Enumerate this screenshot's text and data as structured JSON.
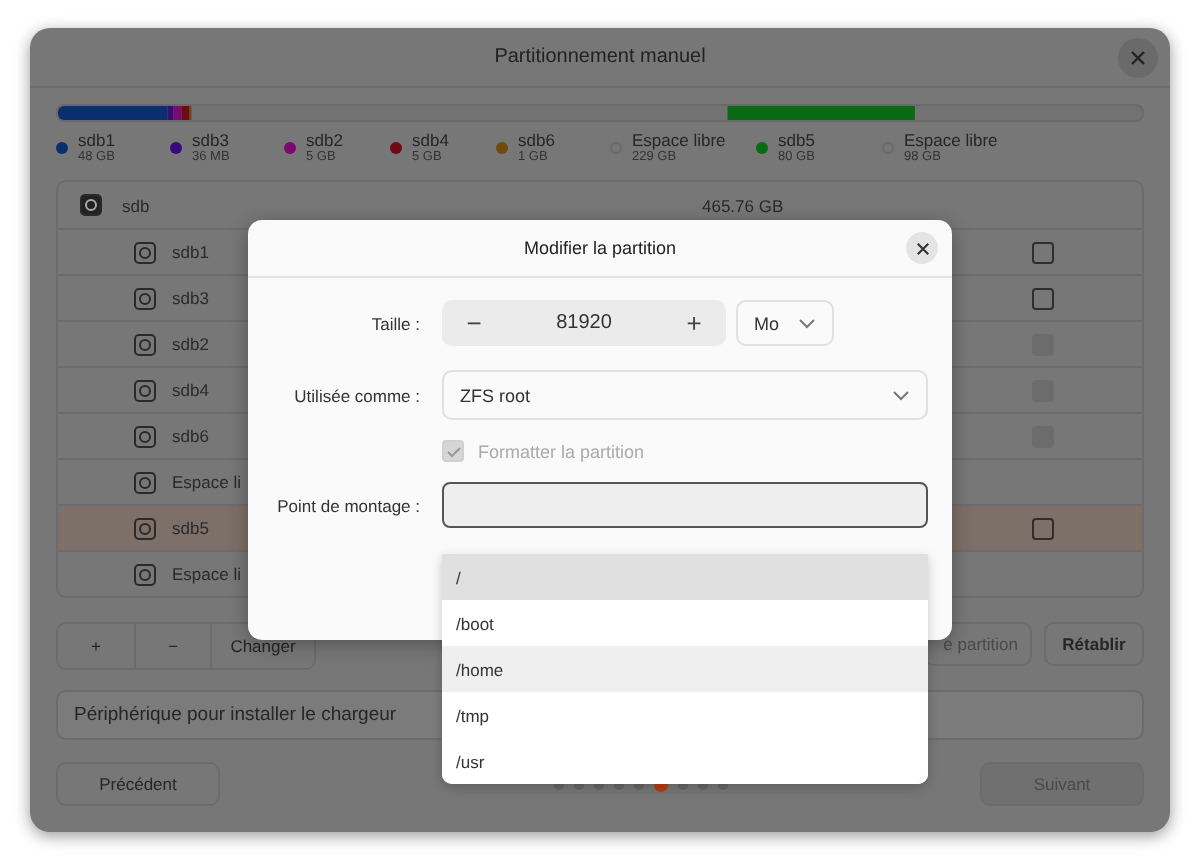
{
  "window": {
    "title": "Partitionnement manuel"
  },
  "usage_bar": [
    {
      "name": "sdb1",
      "size": "48 GB",
      "kind": "partition",
      "color": "#0a2f6e"
    },
    {
      "name": "sdb3",
      "size": "36 MB",
      "kind": "partition",
      "color": "#3a0a7a"
    },
    {
      "name": "sdb2",
      "size": "5 GB",
      "kind": "partition",
      "color": "#7a0a6e"
    },
    {
      "name": "sdb4",
      "size": "5 GB",
      "kind": "partition",
      "color": "#6e0a14"
    },
    {
      "name": "sdb6",
      "size": "1 GB",
      "kind": "partition",
      "color": "#6e4a10"
    },
    {
      "name": "Espace libre",
      "size": "229 GB",
      "kind": "free"
    },
    {
      "name": "sdb5",
      "size": "80 GB",
      "kind": "partition",
      "color": "#0a6a14"
    },
    {
      "name": "Espace libre",
      "size": "98 GB",
      "kind": "free"
    }
  ],
  "table": {
    "device": {
      "name": "sdb",
      "size": "465.76 GB"
    },
    "rows": [
      {
        "name": "sdb1",
        "kind": "partition",
        "selected": false,
        "disabled": false,
        "checked": false
      },
      {
        "name": "sdb3",
        "kind": "partition",
        "selected": false,
        "disabled": false,
        "checked": false
      },
      {
        "name": "sdb2",
        "kind": "partition",
        "selected": false,
        "disabled": true,
        "checked": false
      },
      {
        "name": "sdb4",
        "kind": "partition",
        "selected": false,
        "disabled": true,
        "checked": false
      },
      {
        "name": "sdb6",
        "kind": "partition",
        "selected": false,
        "disabled": true,
        "checked": false
      },
      {
        "name": "Espace li",
        "kind": "free",
        "selected": false
      },
      {
        "name": "sdb5",
        "kind": "partition",
        "selected": true,
        "disabled": false,
        "checked": false
      },
      {
        "name": "Espace li",
        "kind": "free",
        "selected": false
      }
    ]
  },
  "toolbar": {
    "add": "+",
    "remove": "−",
    "change": "Changer",
    "new_table": "e partition",
    "revert": "Rétablir"
  },
  "bootloader": {
    "label": "Périphérique pour installer le chargeur"
  },
  "navigation": {
    "back": "Précédent",
    "next": "Suivant",
    "next_disabled": true,
    "steps": [
      {
        "selected": false
      },
      {
        "selected": false
      },
      {
        "selected": false
      },
      {
        "selected": false
      },
      {
        "selected": false
      },
      {
        "selected": true
      },
      {
        "selected": false
      },
      {
        "selected": false
      },
      {
        "selected": false
      }
    ]
  },
  "dialog": {
    "title": "Modifier la partition",
    "size": {
      "label": "Taille :",
      "minus": "−",
      "value": "81920",
      "plus": "+",
      "unit": "Mo"
    },
    "use_as": {
      "label": "Utilisée comme :",
      "value": "ZFS root"
    },
    "format": {
      "label": "Formatter la partition",
      "checked": true,
      "disabled": true
    },
    "mount_point": {
      "label": "Point de montage :"
    },
    "options": [
      {
        "label": "/",
        "selected": true,
        "hovered": false
      },
      {
        "label": "/boot",
        "selected": false,
        "hovered": false
      },
      {
        "label": "/home",
        "selected": false,
        "hovered": true
      },
      {
        "label": "/tmp",
        "selected": false,
        "hovered": false
      },
      {
        "label": "/usr",
        "selected": false,
        "hovered": false
      }
    ]
  }
}
